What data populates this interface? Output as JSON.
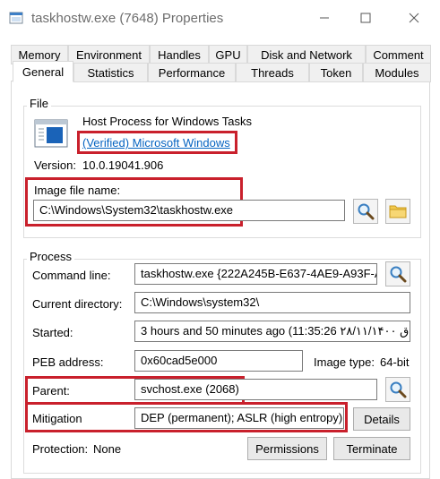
{
  "window": {
    "title": "taskhostw.exe (7648) Properties",
    "minimize_icon": "minimize-icon",
    "maximize_icon": "maximize-icon",
    "close_icon": "close-icon"
  },
  "tabs": {
    "row1": [
      "Memory",
      "Environment",
      "Handles",
      "GPU",
      "Disk and Network",
      "Comment"
    ],
    "row2": [
      "General",
      "Statistics",
      "Performance",
      "Threads",
      "Token",
      "Modules"
    ],
    "active": "General"
  },
  "file": {
    "group_label": "File",
    "description": "Host Process for Windows Tasks",
    "company_link": "(Verified) Microsoft Windows",
    "version_label": "Version:",
    "version_value": "10.0.19041.906",
    "image_file_label": "Image file name:",
    "image_file_value": "C:\\Windows\\System32\\taskhostw.exe"
  },
  "process": {
    "group_label": "Process",
    "command_line_label": "Command line:",
    "command_line_value": "taskhostw.exe {222A245B-E637-4AE9-A93F-A",
    "current_dir_label": "Current directory:",
    "current_dir_value": "C:\\Windows\\system32\\",
    "started_label": "Started:",
    "started_value": "3 hours and 50 minutes ago (11:35:26 ۲۸/۱۱/۱۴۰۰ ق",
    "peb_label": "PEB address:",
    "peb_value": "0x60cad5e000",
    "image_type_label": "Image type:",
    "image_type_value": "64-bit",
    "parent_label": "Parent:",
    "parent_value": "svchost.exe (2068)",
    "mitigation_label": "Mitigation",
    "mitigation_value": "DEP (permanent); ASLR (high entropy);",
    "details_button": "Details",
    "protection_label": "Protection:",
    "protection_value": "None",
    "permissions_button": "Permissions",
    "terminate_button": "Terminate"
  },
  "colors": {
    "highlight_box": "#c9202c",
    "link": "#0563c1"
  }
}
